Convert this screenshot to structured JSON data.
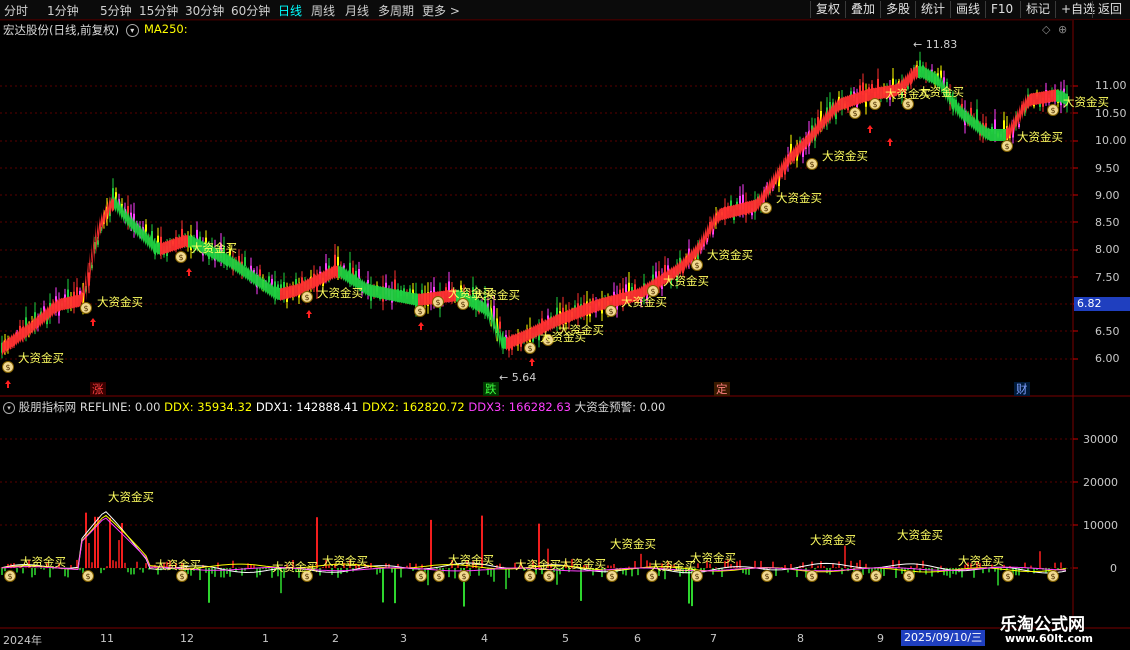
{
  "toolbar": {
    "timeframes": [
      "分时",
      "1分钟",
      "5分钟",
      "15分钟",
      "30分钟",
      "60分钟",
      "日线",
      "周线",
      "月线",
      "多周期",
      "更多 >"
    ],
    "active": "日线",
    "right_buttons": [
      "复权",
      "叠加",
      "多股",
      "统计",
      "画线",
      "F10",
      "标记",
      "+自选",
      "返回"
    ]
  },
  "main_chart": {
    "title": "宏达股份(日线,前复权)",
    "ma_label": "MA250:",
    "price_labels": [
      "11.00",
      "10.50",
      "10.00",
      "9.50",
      "9.00",
      "8.50",
      "8.00",
      "7.50",
      "7.00",
      "6.50",
      "6.00"
    ],
    "current_price": "6.82",
    "high_label": "11.83",
    "low_label": "5.64",
    "signal_text": "大资金买",
    "events": [
      "涨",
      "跌",
      "定",
      "财"
    ]
  },
  "indicator": {
    "name": "股朋指标网",
    "refline": "REFLINE: 0.00",
    "ddx": "DDX: 35934.32",
    "ddx1": "DDX1: 142888.41",
    "ddx2": "DDX2: 162820.72",
    "ddx3": "DDX3: 166282.63",
    "alert": "大资金预警: 0.00",
    "labels": [
      "30000",
      "20000",
      "10000",
      "0"
    ]
  },
  "x_axis": {
    "labels": [
      "2024年",
      "11",
      "12",
      "1",
      "2",
      "3",
      "4",
      "5",
      "6",
      "7",
      "8",
      "9"
    ],
    "current_date": "2025/09/10/三"
  },
  "watermark": {
    "name": "乐淘公式网",
    "url": "www.60lt.com"
  }
}
